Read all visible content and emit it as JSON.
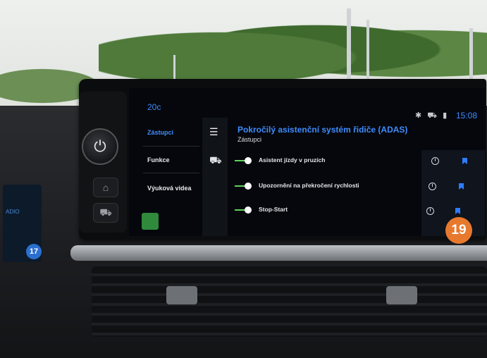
{
  "screen": {
    "temperature": "20c",
    "time": "15:08",
    "status_icons": [
      "bluetooth-icon",
      "car-icon",
      "signal-icon"
    ],
    "nav": [
      {
        "label": "Zástupci",
        "active": true
      },
      {
        "label": "Funkce",
        "active": false
      },
      {
        "label": "Výuková videa",
        "active": false
      }
    ],
    "icon_column": [
      "menu-icon",
      "car-icon"
    ],
    "title": "Pokročilý asistenční systém řidiče (ADAS)",
    "subtitle": "Zástupci",
    "items": [
      {
        "label": "Asistent jízdy v pruzích",
        "enabled": true
      },
      {
        "label": "Upozornění na překročení rychlosti",
        "enabled": true
      },
      {
        "label": "Stop-Start",
        "enabled": true
      }
    ],
    "info_symbol": "i"
  },
  "photo_badge": "19",
  "left_display": {
    "text": "ADIO",
    "badge": "17"
  },
  "colors": {
    "accent": "#3f8cff",
    "toggle_on": "#5dd35d",
    "badge": "#e7792e"
  }
}
